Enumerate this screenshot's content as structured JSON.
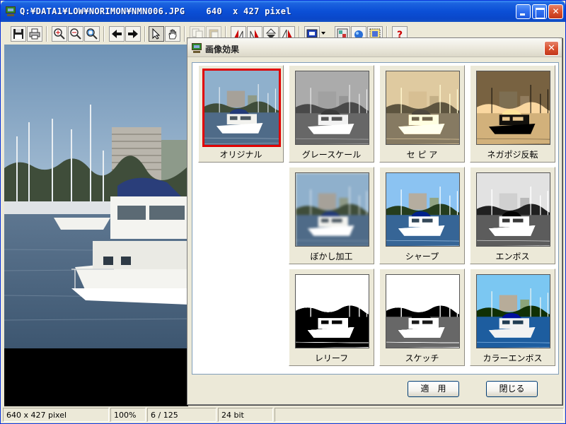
{
  "window": {
    "title": "Q:¥DATA1¥LOW¥NORIMON¥NMN006.JPG    640  x 427 pixel",
    "controls": {
      "minimize": "minimize-icon",
      "maximize": "maximize-icon",
      "close": "close-icon"
    }
  },
  "toolbar": {
    "tools": [
      {
        "name": "save",
        "icon": "floppy-disk-icon"
      },
      {
        "name": "print",
        "icon": "printer-icon"
      },
      {
        "name": "zoom-in",
        "icon": "zoom-in-icon"
      },
      {
        "name": "zoom-out",
        "icon": "zoom-out-icon"
      },
      {
        "name": "zoom-fit",
        "icon": "zoom-fit-icon"
      },
      {
        "name": "previous-image",
        "icon": "arrow-left-icon"
      },
      {
        "name": "next-image",
        "icon": "arrow-right-icon"
      },
      {
        "name": "select",
        "icon": "cursor-icon"
      },
      {
        "name": "hand",
        "icon": "hand-icon"
      },
      {
        "name": "copy",
        "icon": "copy-icon"
      },
      {
        "name": "paste",
        "icon": "paste-icon"
      },
      {
        "name": "rotate-left",
        "icon": "rotate-left-icon"
      },
      {
        "name": "rotate-right",
        "icon": "rotate-right-icon"
      },
      {
        "name": "flip-vertical",
        "icon": "flip-vertical-icon"
      },
      {
        "name": "flip-horizontal",
        "icon": "flip-horizontal-icon"
      },
      {
        "name": "display-mode",
        "icon": "display-icon"
      },
      {
        "name": "slideshow",
        "icon": "slideshow-icon"
      },
      {
        "name": "color-adjust",
        "icon": "color-icon"
      },
      {
        "name": "capture",
        "icon": "capture-icon"
      },
      {
        "name": "help",
        "icon": "help-icon"
      }
    ]
  },
  "dialog": {
    "title": "画像効果",
    "effects": [
      {
        "label": "オリジナル",
        "effect": "original",
        "selected": true
      },
      {
        "label": "グレースケール",
        "effect": "grayscale",
        "selected": false
      },
      {
        "label": "セ ピ ア",
        "effect": "sepia",
        "selected": false
      },
      {
        "label": "ネガポジ反転",
        "effect": "negative",
        "selected": false
      },
      {
        "label": "ぼかし加工",
        "effect": "blur",
        "selected": false
      },
      {
        "label": "シャープ",
        "effect": "sharpen",
        "selected": false
      },
      {
        "label": "エンボス",
        "effect": "emboss",
        "selected": false
      },
      {
        "label": "レリーフ",
        "effect": "relief",
        "selected": false
      },
      {
        "label": "スケッチ",
        "effect": "sketch",
        "selected": false
      },
      {
        "label": "カラーエンボス",
        "effect": "color-emboss",
        "selected": false
      }
    ],
    "apply_label": "適　用",
    "close_label": "閉じる"
  },
  "status": {
    "dimensions": "640 x 427 pixel",
    "zoom": "100%",
    "index": "6  /  125",
    "depth": "24 bit",
    "extra": ""
  }
}
